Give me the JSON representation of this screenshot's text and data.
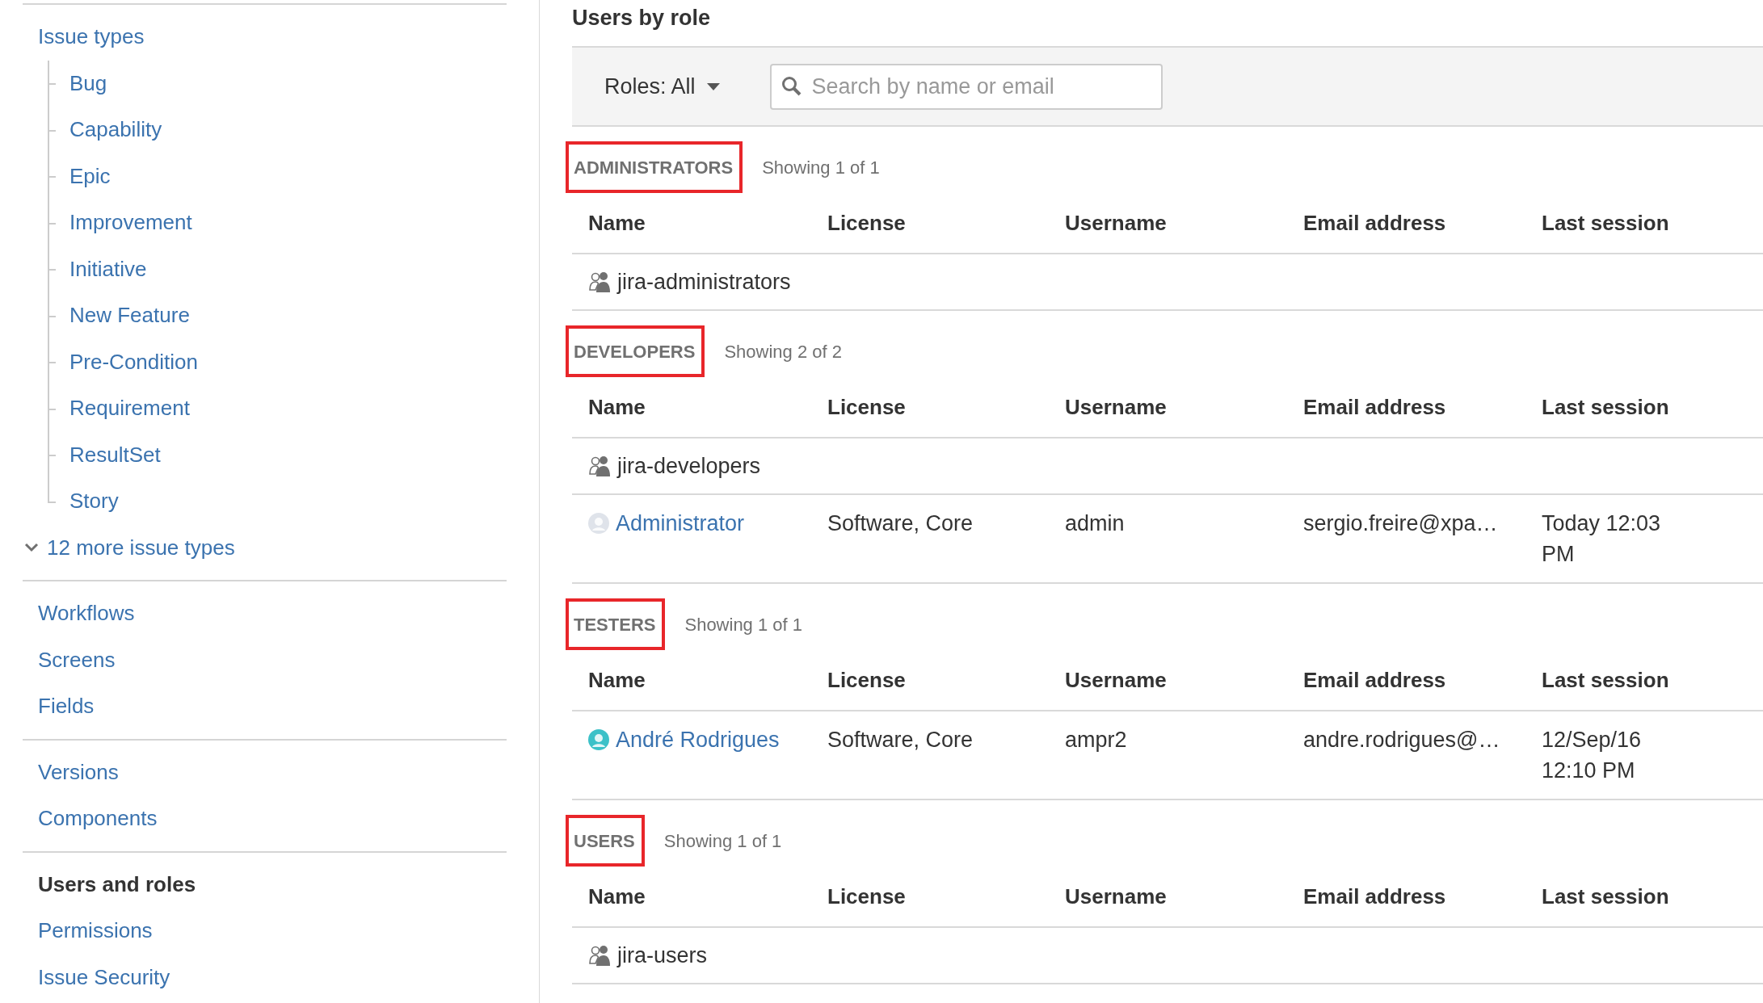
{
  "sidebar": {
    "groups": [
      {
        "items": [
          {
            "kind": "link",
            "label": "Issue types",
            "selected": false,
            "children": [
              {
                "label": "Bug",
                "selected": false
              },
              {
                "label": "Capability",
                "selected": false
              },
              {
                "label": "Epic",
                "selected": false
              },
              {
                "label": "Improvement",
                "selected": false
              },
              {
                "label": "Initiative",
                "selected": false
              },
              {
                "label": "New Feature",
                "selected": false
              },
              {
                "label": "Pre-Condition",
                "selected": false
              },
              {
                "label": "Requirement",
                "selected": false
              },
              {
                "label": "ResultSet",
                "selected": false
              },
              {
                "label": "Story",
                "selected": false
              }
            ]
          },
          {
            "kind": "expander",
            "label": "12 more issue types",
            "expanded": false
          }
        ]
      },
      {
        "items": [
          {
            "kind": "link",
            "label": "Workflows",
            "selected": false
          },
          {
            "kind": "link",
            "label": "Screens",
            "selected": false
          },
          {
            "kind": "link",
            "label": "Fields",
            "selected": false
          }
        ]
      },
      {
        "items": [
          {
            "kind": "link",
            "label": "Versions",
            "selected": false
          },
          {
            "kind": "link",
            "label": "Components",
            "selected": false
          }
        ]
      },
      {
        "items": [
          {
            "kind": "link",
            "label": "Users and roles",
            "selected": true
          },
          {
            "kind": "link",
            "label": "Permissions",
            "selected": false
          },
          {
            "kind": "link",
            "label": "Issue Security",
            "selected": false
          }
        ]
      }
    ]
  },
  "main": {
    "title": "Users by role",
    "filter": {
      "roles_label": "Roles: All",
      "search": {
        "placeholder": "Search by name or email"
      }
    },
    "roles": [
      {
        "name": "ADMINISTRATORS",
        "count": "Showing 1 of 1",
        "highlighted": true,
        "columns": [
          "Name",
          "License",
          "Username",
          "Email address",
          "Last session"
        ],
        "rows": [
          {
            "kind": "group",
            "name": "jira-administrators"
          }
        ]
      },
      {
        "name": "DEVELOPERS",
        "count": "Showing 2 of 2",
        "highlighted": true,
        "columns": [
          "Name",
          "License",
          "Username",
          "Email address",
          "Last session"
        ],
        "rows": [
          {
            "kind": "group",
            "name": "jira-developers"
          },
          {
            "kind": "user",
            "name": "Administrator",
            "color": "#dfe3ea",
            "license": "Software, Core",
            "username": "admin",
            "email": "sergio.freire@xpa…",
            "last_session": "Today 12:03 PM"
          }
        ]
      },
      {
        "name": "TESTERS",
        "count": "Showing 1 of 1",
        "highlighted": true,
        "columns": [
          "Name",
          "License",
          "Username",
          "Email address",
          "Last session"
        ],
        "rows": [
          {
            "kind": "user",
            "name": "André Rodrigues",
            "color": "#3cc1c8",
            "license": "Software, Core",
            "username": "ampr2",
            "email": "andre.rodrigues@…",
            "last_session": "12/Sep/16 12:10 PM"
          }
        ]
      },
      {
        "name": "USERS",
        "count": "Showing 1 of 1",
        "highlighted": true,
        "columns": [
          "Name",
          "License",
          "Username",
          "Email address",
          "Last session"
        ],
        "rows": [
          {
            "kind": "group",
            "name": "jira-users"
          }
        ]
      }
    ]
  }
}
